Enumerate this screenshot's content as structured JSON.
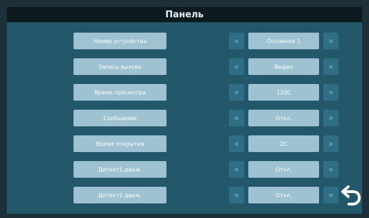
{
  "window": {
    "title": "Панель"
  },
  "rows": [
    {
      "label": "Номер устройства",
      "value": "Основной 1"
    },
    {
      "label": "Запись вызова",
      "value": "Видео"
    },
    {
      "label": "Время просмотра",
      "value": "120С"
    },
    {
      "label": "Сообщение",
      "value": "Откл."
    },
    {
      "label": "Время открытия",
      "value": "2С"
    },
    {
      "label": "Детект1.движ.",
      "value": "Откл."
    },
    {
      "label": "Детект2.движ.",
      "value": "Откл."
    }
  ],
  "arrows": {
    "left": "«",
    "right": "»"
  },
  "icons": {
    "back": "back-arrow-icon",
    "prev": "double-chevron-left-icon",
    "next": "double-chevron-right-icon"
  },
  "colors": {
    "title_bar": "#0d1a20",
    "panel": "#23586b",
    "button": "#9ec2d1",
    "arrow_bg": "#2f6e84"
  }
}
